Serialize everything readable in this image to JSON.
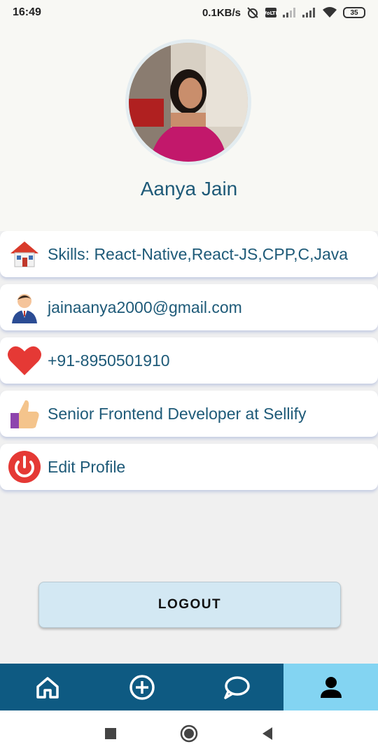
{
  "status_bar": {
    "time": "16:49",
    "network_speed": "0.1KB/s",
    "battery_level": "35"
  },
  "profile": {
    "name": "Aanya Jain"
  },
  "info_items": [
    {
      "icon": "house-icon",
      "text": "Skills: React-Native,React-JS,CPP,C,Java"
    },
    {
      "icon": "person-icon",
      "text": "jainaanya2000@gmail.com"
    },
    {
      "icon": "heart-icon",
      "text": "+91-8950501910"
    },
    {
      "icon": "thumbs-up-icon",
      "text": "Senior Frontend Developer at Sellify"
    },
    {
      "icon": "power-icon",
      "text": "Edit Profile"
    }
  ],
  "logout_label": "LOGOUT",
  "tabs": [
    {
      "icon": "home-icon"
    },
    {
      "icon": "add-circle-icon"
    },
    {
      "icon": "chat-bubble-icon"
    },
    {
      "icon": "profile-icon",
      "active": true
    }
  ],
  "colors": {
    "accent_text": "#1e5a78",
    "tabbar": "#0e5a82",
    "active_tab": "#83d4f2",
    "logout_bg": "#d3e8f3"
  }
}
